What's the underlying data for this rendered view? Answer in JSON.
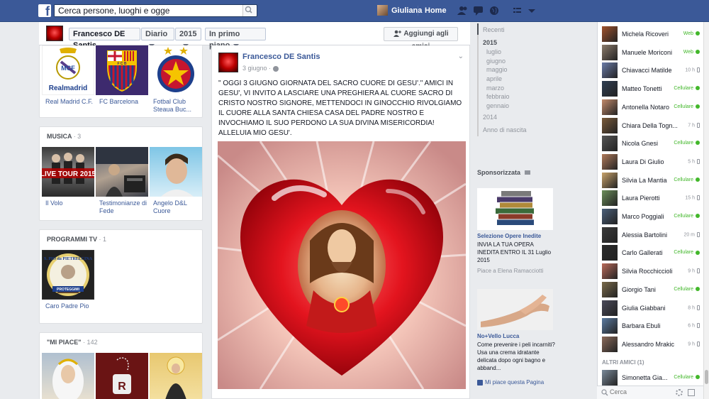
{
  "topbar": {
    "search_placeholder": "Cerca persone, luoghi e ogge",
    "user_name": "Giuliana",
    "home_label": "Home"
  },
  "timeline_nav": {
    "name_button": "Francesco DE Santis",
    "diario_button": "Diario",
    "year_button": "2015",
    "primo_button": "In primo piano",
    "add_friend_button": "Aggiungi agli amici"
  },
  "sports": {
    "tiles": [
      {
        "label": "Real Madrid C.F."
      },
      {
        "label": "FC Barcelona"
      },
      {
        "label": "Fotbal Club Steaua Buc..."
      }
    ]
  },
  "music": {
    "title": "MUSICA",
    "count": "· 3",
    "tiles": [
      {
        "label": "Il Volo"
      },
      {
        "label": "Testimonianze di Fede"
      },
      {
        "label": "Angelo D&L Cuore"
      }
    ]
  },
  "tv": {
    "title": "PROGRAMMI TV",
    "count": "· 1",
    "tiles": [
      {
        "label": "Caro Padre Pio"
      }
    ]
  },
  "likes": {
    "title": "\"MI PIACE\"",
    "count": "· 142"
  },
  "post": {
    "author": "Francesco DE Santis",
    "date": "3 giugno ·",
    "text": "\" OGGI 3 GIUGNO GIORNATA DEL SACRO CUORE DI GESU'.\" AMICI IN\nGESU', VI INVITO A LASCIARE UNA PREGHIERA AL CUORE SACRO DI\nCRISTO NOSTRO SIGNORE, METTENDOCI IN GINOCCHIO RIVOLGIAMO\nIL CUORE ALLA SANTA CHIESA CASA DEL PADRE NOSTRO E\nINVOCHIAMO IL SUO PERDONO LA SUA DIVINA MISERICORDIA!\nALLELUIA MIO GESU'."
  },
  "scrubber": {
    "recent": "Recenti",
    "year_current": "2015",
    "months": [
      "luglio",
      "giugno",
      "maggio",
      "aprile",
      "marzo",
      "febbraio",
      "gennaio"
    ],
    "year_prev": "2014",
    "birth": "Anno di nascita"
  },
  "sponsored": {
    "title": "Sponsorizzata",
    "ads": [
      {
        "title": "Selezione Opere Inedite",
        "body": "INVIA LA TUA OPERA INEDITA ENTRO IL 31 Luglio 2015",
        "social": "Piace a Elena Ramacciotti"
      },
      {
        "title": "No+Vello Lucca",
        "body": "Come prevenire i peli incarniti? Usa una crema idratante delicata dopo ogni bagno e abband...",
        "social": "Mi piace questa Pagina"
      }
    ]
  },
  "chat": {
    "friends": [
      {
        "name": "Michela Ricoveri",
        "status": "Web",
        "online": true,
        "color": "#a0522d"
      },
      {
        "name": "Manuele Moriconi",
        "status": "Web",
        "online": true,
        "color": "#8b7b6b"
      },
      {
        "name": "Chiavacci Matilde",
        "status": "10 h",
        "online": false,
        "color": "#6a7ba8"
      },
      {
        "name": "Matteo Tonetti",
        "status": "Cellulare",
        "online": true,
        "color": "#2f3e52"
      },
      {
        "name": "Antonella Notaro",
        "status": "Cellulare",
        "online": true,
        "color": "#c28a6a"
      },
      {
        "name": "Chiara Della Togn...",
        "status": "7 h",
        "online": false,
        "color": "#7a5a3a"
      },
      {
        "name": "Nicola Gnesi",
        "status": "Cellulare",
        "online": true,
        "color": "#555555"
      },
      {
        "name": "Laura Di Giulio",
        "status": "5 h",
        "online": false,
        "color": "#b07a5a"
      },
      {
        "name": "Silvia La Mantia",
        "status": "Cellulare",
        "online": true,
        "color": "#c9a36b"
      },
      {
        "name": "Laura Pierotti",
        "status": "15 h",
        "online": false,
        "color": "#6b8e5a"
      },
      {
        "name": "Marco Poggiali",
        "status": "Cellulare",
        "online": true,
        "color": "#4a5f7a"
      },
      {
        "name": "Alessia Bartolini",
        "status": "20 m",
        "online": false,
        "color": "#3a3a3a"
      },
      {
        "name": "Carlo Gallerati",
        "status": "Cellulare",
        "online": true,
        "color": "#2a2a2a"
      },
      {
        "name": "Silvia Rocchiccioli",
        "status": "9 h",
        "online": false,
        "color": "#b96a5a"
      },
      {
        "name": "Giorgio Tani",
        "status": "Cellulare",
        "online": true,
        "color": "#7a6a4a"
      },
      {
        "name": "Giulia Giabbani",
        "status": "8 h",
        "online": false,
        "color": "#4a4a5a"
      },
      {
        "name": "Barbara Ebuli",
        "status": "6 h",
        "online": false,
        "color": "#5a7aa0"
      },
      {
        "name": "Alessandro Mrakic",
        "status": "9 h",
        "online": false,
        "color": "#8a6a5a"
      }
    ],
    "section": "ALTRI AMICI (1)",
    "other": {
      "name": "Simonetta Gia...",
      "status": "Cellulare",
      "online": true,
      "color": "#7a8a9a"
    },
    "search_placeholder": "Cerca"
  }
}
